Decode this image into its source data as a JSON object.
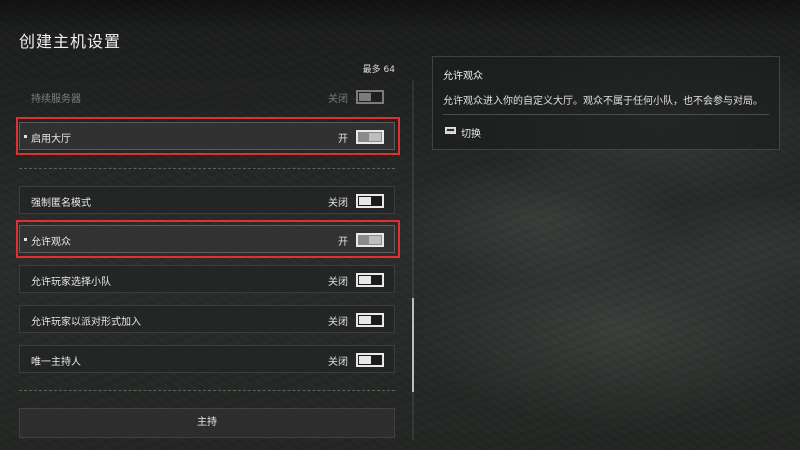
{
  "page": {
    "title": "创建主机设置",
    "max_players_label": "最多 64"
  },
  "settings": [
    {
      "label": "持续服务器",
      "value": "关闭",
      "state": "off",
      "disabled": true
    },
    {
      "label": "启用大厅",
      "value": "开",
      "state": "on",
      "highlighted": true
    },
    {
      "label": "强制匿名模式",
      "value": "关闭",
      "state": "off"
    },
    {
      "label": "允许观众",
      "value": "开",
      "state": "on",
      "highlighted": true
    },
    {
      "label": "允许玩家选择小队",
      "value": "关闭",
      "state": "off"
    },
    {
      "label": "允许玩家以派对形式加入",
      "value": "关闭",
      "state": "off"
    },
    {
      "label": "唯一主持人",
      "value": "关闭",
      "state": "off"
    }
  ],
  "host_button": {
    "label": "主持"
  },
  "info_panel": {
    "title": "允许观众",
    "description": "允许观众进入你的自定义大厅。观众不属于任何小队，也不会参与对局。",
    "action_label": "切换",
    "action_icon": "keyboard-icon"
  },
  "colors": {
    "highlight": "#e03030",
    "toggle": "#e8e8e8"
  }
}
